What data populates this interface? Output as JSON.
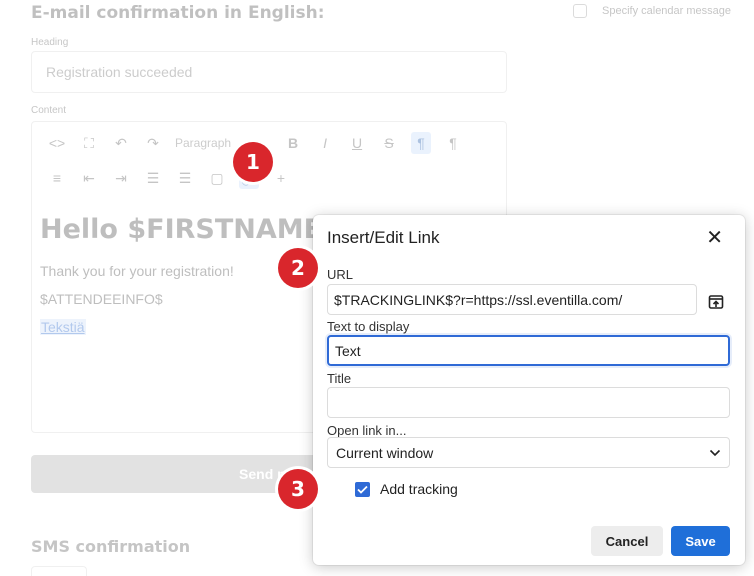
{
  "background": {
    "section_title": "E-mail confirmation in English:",
    "calendar_checkbox_label": "Specify calendar message",
    "heading_label": "Heading",
    "heading_value": "Registration succeeded",
    "content_label": "Content",
    "toolbar": {
      "paragraph_select": "Paragraph"
    },
    "editor": {
      "hello": "Hello $FIRSTNAME$",
      "thanks": "Thank you for your registration!",
      "attendee_info": "$ATTENDEEINFO$",
      "link_text": "Tekstiä"
    },
    "send_button": "Send pre",
    "sms_title": "SMS confirmation"
  },
  "dialog": {
    "title": "Insert/Edit Link",
    "url_label": "URL",
    "url_value": "$TRACKINGLINK$?r=https://ssl.eventilla.com/",
    "text_label": "Text to display",
    "text_value": "Text",
    "title_label": "Title",
    "title_value": "",
    "open_label": "Open link in...",
    "open_value": "Current window",
    "tracking_label": "Add tracking",
    "tracking_checked": true,
    "cancel_label": "Cancel",
    "save_label": "Save"
  },
  "badges": [
    "1",
    "2",
    "3"
  ],
  "colors": {
    "badge": "#d9262c",
    "primary": "#1f6fd9",
    "focus": "#2f6ad6"
  }
}
